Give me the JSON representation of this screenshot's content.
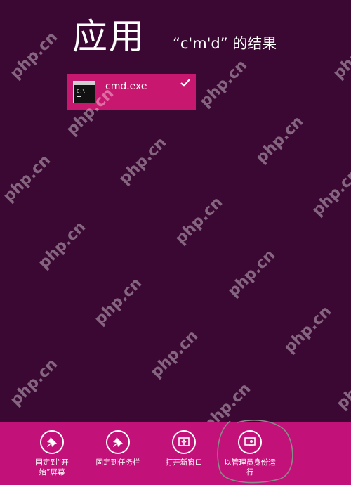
{
  "header": {
    "title": "应用",
    "query": "“c'm'd” 的结果"
  },
  "results": [
    {
      "label": "cmd.exe",
      "selected": true,
      "icon": "console-window-icon"
    }
  ],
  "watermark": "php.cn",
  "appbar": {
    "commands": [
      {
        "label": "固定到“开\n始”屏幕",
        "icon": "pin-icon"
      },
      {
        "label": "固定到任务栏",
        "icon": "pin-icon"
      },
      {
        "label": "打开新窗口",
        "icon": "new-window-icon"
      },
      {
        "label": "以管理员身份运\n行",
        "icon": "run-as-admin-icon"
      }
    ]
  },
  "colors": {
    "background": "#3b0833",
    "tile": "#c8176e",
    "appbar": "#c2127a"
  }
}
